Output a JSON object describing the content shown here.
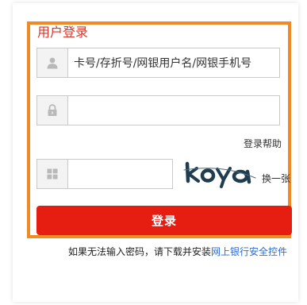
{
  "login": {
    "title": "用户登录",
    "username_placeholder": "卡号/存折号/网银用户名/网银手机号",
    "password_value": "",
    "help_label": "登录帮助",
    "captcha_value": "",
    "captcha_image_text": "koya",
    "refresh_label": "换一张",
    "submit_label": "登录"
  },
  "footer": {
    "note_prefix": "如果无法输入密码，请下载并安装",
    "note_link": "网上银行安全控件"
  },
  "colors": {
    "frame_border": "#f08a24",
    "title": "#d9362b",
    "button": "#e61e12",
    "link": "#2a6ad9"
  },
  "icons": {
    "username": "user-icon",
    "password": "lock-icon",
    "captcha": "grid-icon"
  }
}
